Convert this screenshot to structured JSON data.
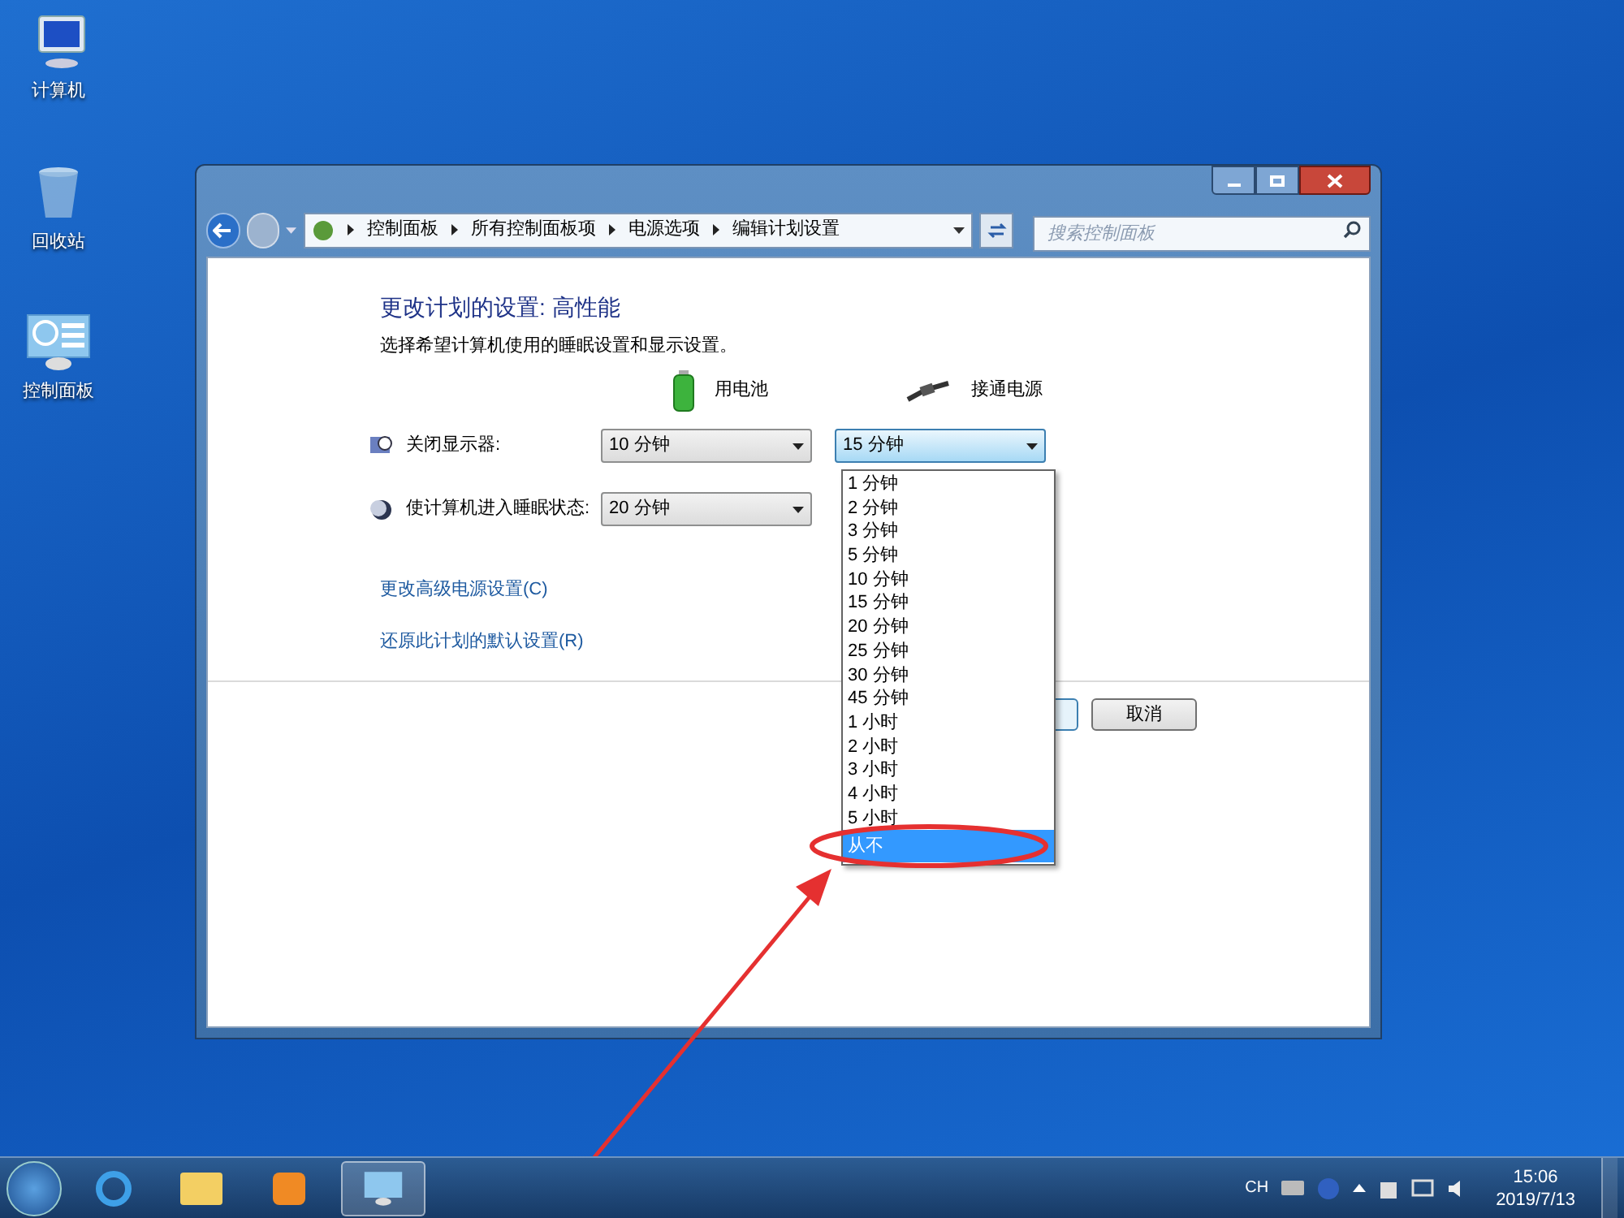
{
  "desktop_icons": [
    {
      "kind": "computer",
      "label": "计算机"
    },
    {
      "kind": "recycle",
      "label": "回收站"
    },
    {
      "kind": "panel",
      "label": "控制面板"
    }
  ],
  "window": {
    "breadcrumb": [
      "控制面板",
      "所有控制面板项",
      "电源选项",
      "编辑计划设置"
    ],
    "search": {
      "placeholder": "搜索控制面板"
    }
  },
  "content": {
    "title": "更改计划的设置: 高性能",
    "subtitle": "选择希望计算机使用的睡眠设置和显示设置。",
    "columns": [
      {
        "kind": "battery",
        "label": "用电池"
      },
      {
        "kind": "plug",
        "label": "接通电源"
      }
    ],
    "settings": [
      {
        "kind": "display",
        "label": "关闭显示器:",
        "values": [
          "10 分钟",
          "15 分钟"
        ],
        "focused": [
          false,
          true
        ]
      },
      {
        "kind": "sleep",
        "label": "使计算机进入睡眠状态:",
        "values": [
          "20 分钟"
        ],
        "focused": [
          false
        ]
      }
    ],
    "links": [
      "更改高级电源设置(C)",
      "还原此计划的默认设置(R)"
    ],
    "buttons": [
      {
        "kind": "save"
      },
      {
        "kind": "cancel",
        "label": "取消"
      }
    ]
  },
  "dropdown": {
    "options": [
      {
        "label": "1 分钟",
        "selected": false
      },
      {
        "label": "2 分钟",
        "selected": false
      },
      {
        "label": "3 分钟",
        "selected": false
      },
      {
        "label": "5 分钟",
        "selected": false
      },
      {
        "label": "10 分钟",
        "selected": false
      },
      {
        "label": "15 分钟",
        "selected": false
      },
      {
        "label": "20 分钟",
        "selected": false
      },
      {
        "label": "25 分钟",
        "selected": false
      },
      {
        "label": "30 分钟",
        "selected": false
      },
      {
        "label": "45 分钟",
        "selected": false
      },
      {
        "label": "1 小时",
        "selected": false
      },
      {
        "label": "2 小时",
        "selected": false
      },
      {
        "label": "3 小时",
        "selected": false
      },
      {
        "label": "4 小时",
        "selected": false
      },
      {
        "label": "5 小时",
        "selected": false
      },
      {
        "label": "从不",
        "selected": true
      }
    ]
  },
  "taskbar": {
    "tray_language": "CH",
    "time": "15:06",
    "date": "2019/7/13"
  }
}
